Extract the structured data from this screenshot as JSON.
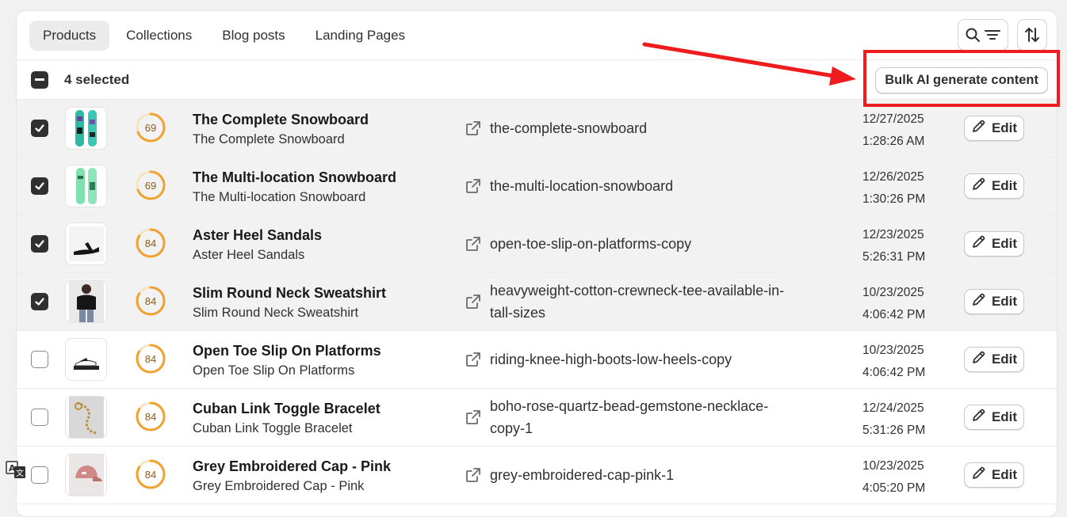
{
  "tabs": [
    {
      "label": "Products",
      "active": true
    },
    {
      "label": "Collections",
      "active": false
    },
    {
      "label": "Blog posts",
      "active": false
    },
    {
      "label": "Landing Pages",
      "active": false
    }
  ],
  "toolbar": {
    "search_filter_icon": "search-filter-icon",
    "sort_icon": "sort-icon"
  },
  "bulk": {
    "selected_label": "4 selected",
    "button_label": "Bulk AI generate content"
  },
  "rows": [
    {
      "checked": true,
      "score": "69",
      "score_fraction": 0.69,
      "title": "The Complete Snowboard",
      "subtitle": "The Complete Snowboard",
      "handle": "the-complete-snowboard",
      "date": "12/27/2025",
      "time": "1:28:26 AM",
      "edit": "Edit",
      "thumb": "snowboard-teal"
    },
    {
      "checked": true,
      "score": "69",
      "score_fraction": 0.69,
      "title": "The Multi-location Snowboard",
      "subtitle": "The Multi-location Snowboard",
      "handle": "the-multi-location-snowboard",
      "date": "12/26/2025",
      "time": "1:30:26 PM",
      "edit": "Edit",
      "thumb": "snowboard-green"
    },
    {
      "checked": true,
      "score": "84",
      "score_fraction": 0.84,
      "title": "Aster Heel Sandals",
      "subtitle": "Aster Heel Sandals",
      "handle": "open-toe-slip-on-platforms-copy",
      "date": "12/23/2025",
      "time": "5:26:31 PM",
      "edit": "Edit",
      "thumb": "sandal"
    },
    {
      "checked": true,
      "score": "84",
      "score_fraction": 0.84,
      "title": "Slim Round Neck Sweatshirt",
      "subtitle": "Slim Round Neck Sweatshirt",
      "handle": "heavyweight-cotton-crewneck-tee-available-in-tall-sizes",
      "date": "10/23/2025",
      "time": "4:06:42 PM",
      "edit": "Edit",
      "thumb": "person-sweatshirt"
    },
    {
      "checked": false,
      "score": "84",
      "score_fraction": 0.84,
      "title": "Open Toe Slip On Platforms",
      "subtitle": "Open Toe Slip On Platforms",
      "handle": "riding-knee-high-boots-low-heels-copy",
      "date": "10/23/2025",
      "time": "4:06:42 PM",
      "edit": "Edit",
      "thumb": "platform-sandal"
    },
    {
      "checked": false,
      "score": "84",
      "score_fraction": 0.84,
      "title": "Cuban Link Toggle Bracelet",
      "subtitle": "Cuban Link Toggle Bracelet",
      "handle": "boho-rose-quartz-bead-gemstone-necklace-copy-1",
      "date": "12/24/2025",
      "time": "5:31:26 PM",
      "edit": "Edit",
      "thumb": "bracelet"
    },
    {
      "checked": false,
      "score": "84",
      "score_fraction": 0.84,
      "title": "Grey Embroidered Cap - Pink",
      "subtitle": "Grey Embroidered Cap - Pink",
      "handle": "grey-embroidered-cap-pink-1",
      "date": "10/23/2025",
      "time": "4:05:20 PM",
      "edit": "Edit",
      "thumb": "cap-pink"
    }
  ],
  "colors": {
    "annotation_red": "#ee1c1c",
    "score_ring": "#f0a12e",
    "selected_row_bg": "#f1f2f1"
  }
}
